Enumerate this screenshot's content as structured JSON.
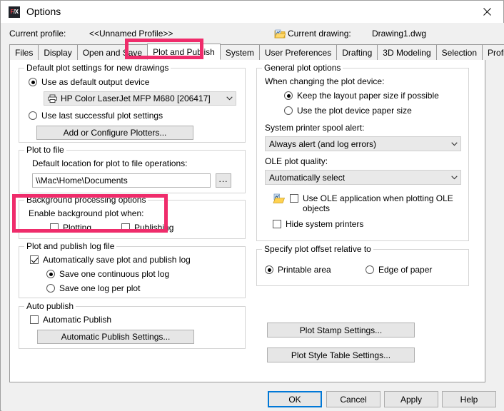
{
  "window": {
    "title": "Options",
    "app_icon": "fx-logo-icon",
    "close_icon": "close-icon"
  },
  "header": {
    "profile_label": "Current profile:",
    "profile_value": "<<Unnamed Profile>>",
    "drawing_icon": "drawing-file-icon",
    "drawing_label": "Current drawing:",
    "drawing_value": "Drawing1.dwg"
  },
  "tabs": [
    {
      "label": "Files",
      "active": false
    },
    {
      "label": "Display",
      "active": false
    },
    {
      "label": "Open and Save",
      "active": false
    },
    {
      "label": "Plot and Publish",
      "active": true
    },
    {
      "label": "System",
      "active": false
    },
    {
      "label": "User Preferences",
      "active": false
    },
    {
      "label": "Drafting",
      "active": false
    },
    {
      "label": "3D Modeling",
      "active": false
    },
    {
      "label": "Selection",
      "active": false
    },
    {
      "label": "Profiles",
      "active": false
    }
  ],
  "left": {
    "default_plot": {
      "legend": "Default plot settings for new drawings",
      "radio_default_device": "Use as default output device",
      "radio_default_device_checked": true,
      "device_combo_value": "HP Color LaserJet MFP M680 [206417]",
      "device_combo_icon": "printer-icon",
      "radio_last_settings": "Use last successful plot settings",
      "radio_last_settings_checked": false,
      "button_add_plotters": "Add or Configure Plotters..."
    },
    "plot_to_file": {
      "legend": "Plot to file",
      "label_location": "Default location for plot to file operations:",
      "path_value": "\\\\Mac\\Home\\Documents",
      "browse_button": "...",
      "browse_icon": "ellipsis-icon"
    },
    "background": {
      "legend": "Background processing options",
      "label_enable": "Enable background plot when:",
      "check_plotting": "Plotting",
      "check_plotting_checked": false,
      "check_publishing": "Publishing",
      "check_publishing_checked": false
    },
    "log_file": {
      "legend": "Plot and publish log file",
      "check_autosave": "Automatically save plot and publish log",
      "check_autosave_checked": true,
      "radio_continuous": "Save one continuous plot log",
      "radio_continuous_checked": true,
      "radio_per_plot": "Save one log per plot",
      "radio_per_plot_checked": false
    },
    "auto_publish": {
      "legend": "Auto publish",
      "check_automatic": "Automatic Publish",
      "check_automatic_checked": false,
      "button_settings": "Automatic Publish Settings..."
    }
  },
  "right": {
    "general": {
      "legend": "General plot options",
      "label_when_changing": "When changing the plot device:",
      "radio_keep_layout": "Keep the layout paper size if possible",
      "radio_keep_layout_checked": true,
      "radio_use_device": "Use the plot device paper size",
      "radio_use_device_checked": false,
      "label_spool_alert": "System printer spool alert:",
      "spool_combo_value": "Always alert (and log errors)",
      "label_ole_quality": "OLE plot quality:",
      "ole_combo_value": "Automatically select",
      "ole_icon": "ole-object-icon",
      "check_use_ole": "Use OLE application when plotting OLE objects",
      "check_use_ole_checked": false,
      "check_hide_printers": "Hide system printers",
      "check_hide_printers_checked": false
    },
    "offset": {
      "legend": "Specify plot offset relative to",
      "radio_printable": "Printable area",
      "radio_printable_checked": true,
      "radio_edge": "Edge of paper",
      "radio_edge_checked": false
    },
    "button_plot_stamp": "Plot Stamp Settings...",
    "button_plot_style": "Plot Style Table Settings..."
  },
  "footer": {
    "ok": "OK",
    "cancel": "Cancel",
    "apply": "Apply",
    "help": "Help"
  },
  "annotations": {
    "accent_color": "#ef2c6b",
    "highlight_tab": "Plot and Publish",
    "highlight_group": "Background processing options"
  }
}
